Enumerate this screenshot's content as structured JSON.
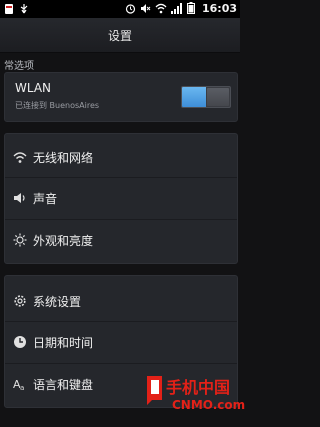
{
  "status_bar": {
    "time": "16:03",
    "left_icons": [
      "app-notification-icon",
      "usb-icon"
    ],
    "right_icons": [
      "alarm-icon",
      "mute-icon",
      "wifi-icon",
      "signal-icon",
      "battery-icon"
    ]
  },
  "header": {
    "title": "设置"
  },
  "section": {
    "header": "常选项"
  },
  "wlan": {
    "title": "WLAN",
    "status": "已连接到 BuenosAires",
    "enabled": true
  },
  "menu_network": [
    {
      "label": "无线和网络",
      "icon": "wifi-icon"
    },
    {
      "label": "声音",
      "icon": "speaker-icon"
    },
    {
      "label": "外观和亮度",
      "icon": "brightness-icon"
    }
  ],
  "menu_system": [
    {
      "label": "系统设置",
      "icon": "gear-icon"
    },
    {
      "label": "日期和时间",
      "icon": "clock-icon"
    },
    {
      "label": "语言和键盘",
      "icon": "language-icon"
    }
  ],
  "watermark": {
    "text": "手机中国",
    "sub": "CNMO.com"
  },
  "colors": {
    "background": "#121214",
    "card": "#25272c",
    "toggle_on": "#4a9ee3",
    "watermark_red": "#e32118"
  }
}
